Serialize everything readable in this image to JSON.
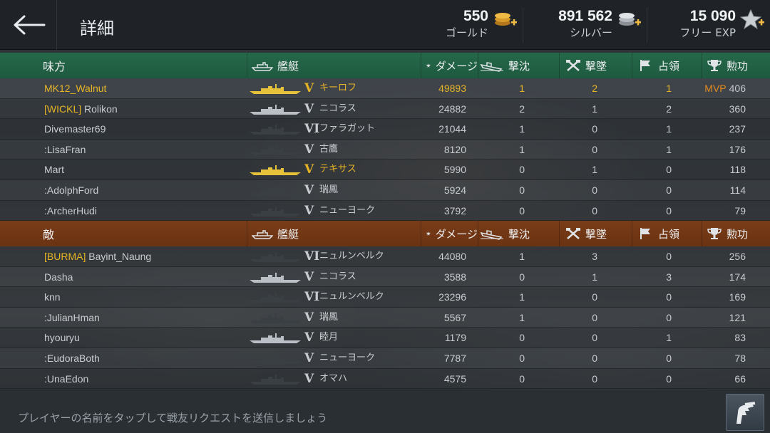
{
  "header": {
    "title": "詳細",
    "currencies": [
      {
        "amount": "550",
        "label": "ゴールド",
        "icon": "gold-coins-icon"
      },
      {
        "amount": "891 562",
        "label": "シルバー",
        "icon": "silver-coins-icon"
      },
      {
        "amount": "15 090",
        "label": "フリー EXP",
        "icon": "free-exp-star-icon"
      }
    ]
  },
  "columns": {
    "ship": "艦艇",
    "damage": "ダメージ",
    "kills": "撃沈",
    "planes": "撃墜",
    "capture": "占領",
    "merit": "勲功"
  },
  "allies": {
    "label": "味方",
    "rows": [
      {
        "clan": "",
        "name": "MK12_Walnut",
        "tier": "V",
        "ship": "キーロフ",
        "damage": "49893",
        "kills": "1",
        "planes": "2",
        "capture": "1",
        "mvp": "MVP",
        "merit": "406"
      },
      {
        "clan": "[WICKL]",
        "name": " Rolikon",
        "tier": "V",
        "ship": "ニコラス",
        "damage": "24882",
        "kills": "2",
        "planes": "1",
        "capture": "2",
        "mvp": "",
        "merit": "360"
      },
      {
        "clan": "",
        "name": "Divemaster69",
        "tier": "VI",
        "ship": "ファラガット",
        "damage": "21044",
        "kills": "1",
        "planes": "0",
        "capture": "1",
        "mvp": "",
        "merit": "237"
      },
      {
        "clan": "",
        "name": ":LisaFran",
        "tier": "V",
        "ship": "古鷹",
        "damage": "8120",
        "kills": "1",
        "planes": "0",
        "capture": "1",
        "mvp": "",
        "merit": "176"
      },
      {
        "clan": "",
        "name": "Mart",
        "tier": "V",
        "ship": "テキサス",
        "damage": "5990",
        "kills": "0",
        "planes": "1",
        "capture": "0",
        "mvp": "",
        "merit": "118"
      },
      {
        "clan": "",
        "name": ":AdolphFord",
        "tier": "V",
        "ship": "瑞鳳",
        "damage": "5924",
        "kills": "0",
        "planes": "0",
        "capture": "0",
        "mvp": "",
        "merit": "114"
      },
      {
        "clan": "",
        "name": ":ArcherHudi",
        "tier": "V",
        "ship": "ニューヨーク",
        "damage": "3792",
        "kills": "0",
        "planes": "0",
        "capture": "0",
        "mvp": "",
        "merit": "79"
      }
    ]
  },
  "enemies": {
    "label": "敵",
    "rows": [
      {
        "clan": "[BURMA]",
        "name": " Bayint_Naung",
        "tier": "VI",
        "ship": "ニュルンベルク",
        "damage": "44080",
        "kills": "1",
        "planes": "3",
        "capture": "0",
        "mvp": "",
        "merit": "256"
      },
      {
        "clan": "",
        "name": "Dasha",
        "tier": "V",
        "ship": "ニコラス",
        "damage": "3588",
        "kills": "0",
        "planes": "1",
        "capture": "3",
        "mvp": "",
        "merit": "174"
      },
      {
        "clan": "",
        "name": "knn",
        "tier": "VI",
        "ship": "ニュルンベルク",
        "damage": "23296",
        "kills": "1",
        "planes": "0",
        "capture": "0",
        "mvp": "",
        "merit": "169"
      },
      {
        "clan": "",
        "name": ":JulianHman",
        "tier": "V",
        "ship": "瑞鳳",
        "damage": "5567",
        "kills": "1",
        "planes": "0",
        "capture": "0",
        "mvp": "",
        "merit": "121"
      },
      {
        "clan": "",
        "name": "hyouryu",
        "tier": "V",
        "ship": "睦月",
        "damage": "1179",
        "kills": "0",
        "planes": "0",
        "capture": "1",
        "mvp": "",
        "merit": "83"
      },
      {
        "clan": "",
        "name": ":EudoraBoth",
        "tier": "V",
        "ship": "ニューヨーク",
        "damage": "7787",
        "kills": "0",
        "planes": "0",
        "capture": "0",
        "mvp": "",
        "merit": "78"
      },
      {
        "clan": "",
        "name": ":UnaEdon",
        "tier": "V",
        "ship": "オマハ",
        "damage": "4575",
        "kills": "0",
        "planes": "0",
        "capture": "0",
        "mvp": "",
        "merit": "66"
      }
    ]
  },
  "footer": {
    "hint": "プレイヤーの名前をタップして戦友リクエストを送信しましょう",
    "friend_button_icon": "friend-request-icon"
  },
  "colors": {
    "ally_header": "#1e5a3f",
    "enemy_header": "#6a3312",
    "highlight_gold": "#e6b425",
    "mvp_orange": "#e28a1c"
  }
}
